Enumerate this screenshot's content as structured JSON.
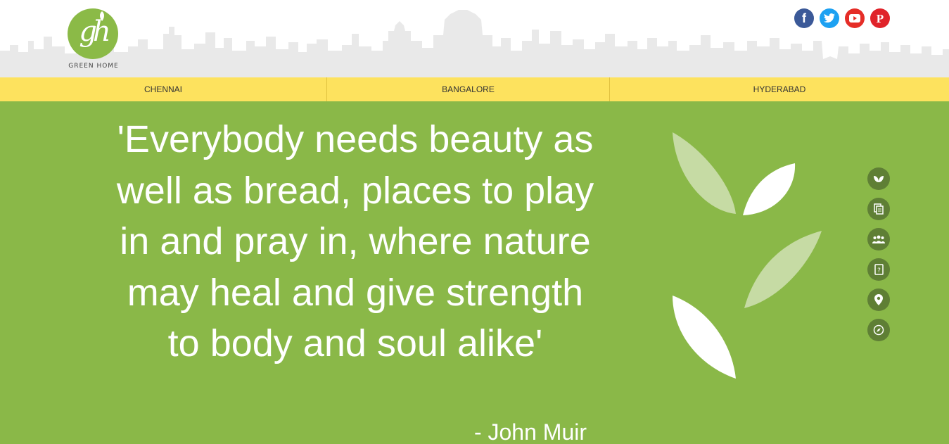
{
  "brand": {
    "logo_mark": "gh",
    "name": "GREEN HOME"
  },
  "social": [
    {
      "name": "facebook-icon",
      "glyph": "f",
      "color": "#3b5998"
    },
    {
      "name": "twitter-icon",
      "color": "#1da1f2"
    },
    {
      "name": "youtube-icon",
      "color": "#e52d27"
    },
    {
      "name": "pinterest-icon",
      "glyph": "P",
      "color": "#e0232a"
    }
  ],
  "nav": {
    "items": [
      "CHENNAI",
      "BANGALORE",
      "HYDERABAD"
    ]
  },
  "hero": {
    "quote": "'Everybody needs beauty as well as bread, places to play in and pray in, where nature may heal and give strength to body and soul alike'",
    "author": "- John Muir"
  },
  "side_nav": [
    {
      "name": "leaf-icon"
    },
    {
      "name": "documents-icon"
    },
    {
      "name": "people-icon"
    },
    {
      "name": "contact-book-icon"
    },
    {
      "name": "location-pin-icon"
    },
    {
      "name": "compass-icon"
    }
  ],
  "colors": {
    "green": "#8ab848",
    "yellow": "#fde25e",
    "dark_green": "#5f7f35",
    "skyline": "#e8e8e8"
  }
}
